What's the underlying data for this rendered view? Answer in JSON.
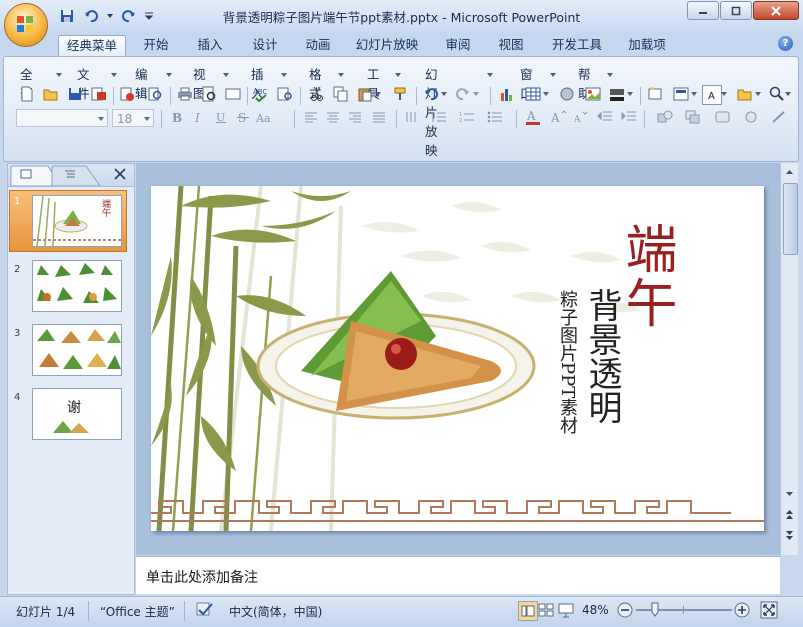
{
  "window": {
    "title": "背景透明粽子图片端午节ppt素材.pptx - Microsoft PowerPoint"
  },
  "ribbon_tabs": [
    "经典菜单",
    "开始",
    "插入",
    "设计",
    "动画",
    "幻灯片放映",
    "审阅",
    "视图",
    "开发工具",
    "加载项"
  ],
  "menus": [
    "全部",
    "文件",
    "编辑",
    "视图",
    "插入",
    "格式",
    "工具",
    "幻灯片放映",
    "窗口",
    "帮助"
  ],
  "font": {
    "size": "18"
  },
  "panel": {
    "slides": [
      {
        "num": "1",
        "thumb_text": "端午"
      },
      {
        "num": "2",
        "thumb_text": ""
      },
      {
        "num": "3",
        "thumb_text": ""
      },
      {
        "num": "4",
        "thumb_text": "谢"
      }
    ]
  },
  "slide": {
    "title": "端午",
    "subtitle": "背景透明",
    "caption": "粽子图片PPT素材"
  },
  "notes_placeholder": "单击此处添加备注",
  "status": {
    "slide_indicator": "幻灯片 1/4",
    "theme": "“Office 主题”",
    "language": "中文(简体，中国)",
    "zoom": "48%"
  },
  "colors": {
    "accent_red": "#9b1f1f",
    "bamboo": "#8a9a4a",
    "ribbon_blue": "#c5d8ef"
  }
}
